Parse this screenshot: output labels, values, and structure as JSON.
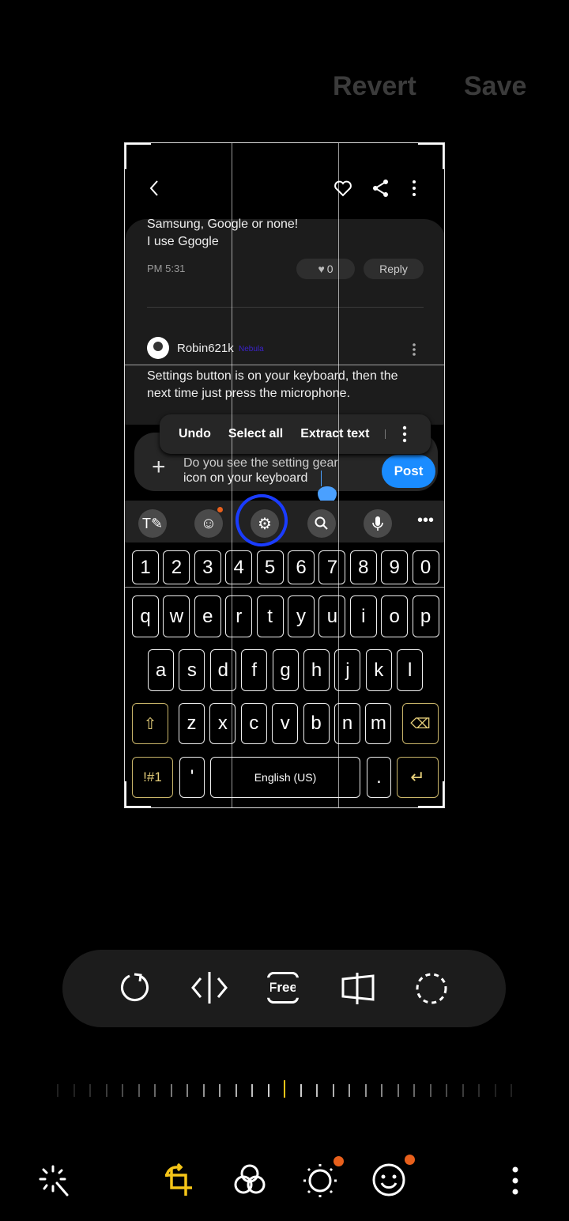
{
  "header": {
    "revert_label": "Revert",
    "save_label": "Save"
  },
  "screenshot": {
    "comment1": {
      "line1": "Samsung, Google or none!",
      "line2": "I use Ggogle",
      "time": "PM 5:31",
      "likes": "0",
      "reply_label": "Reply"
    },
    "comment2": {
      "user": "Robin621k",
      "badge": "Nebula",
      "text_line1": "Settings button is on your keyboard, then the",
      "text_line2": "next time just press the microphone."
    },
    "context_menu": {
      "undo": "Undo",
      "select_all": "Select all",
      "extract_text": "Extract text"
    },
    "compose": {
      "line1": "Do you see the setting gear",
      "line2": "icon on your keyboard",
      "post_label": "Post",
      "post_color": "#1a8cff"
    },
    "keyboard": {
      "toolbar_icons": [
        "text-edit-icon",
        "emoji-icon",
        "gear-icon",
        "search-icon",
        "microphone-icon",
        "more-icon"
      ],
      "row_numbers": [
        "1",
        "2",
        "3",
        "4",
        "5",
        "6",
        "7",
        "8",
        "9",
        "0"
      ],
      "row1": [
        "q",
        "w",
        "e",
        "r",
        "t",
        "y",
        "u",
        "i",
        "o",
        "p"
      ],
      "row2": [
        "a",
        "s",
        "d",
        "f",
        "g",
        "h",
        "j",
        "k",
        "l"
      ],
      "row3": [
        "z",
        "x",
        "c",
        "v",
        "b",
        "n",
        "m"
      ],
      "symbols_label": "!#1",
      "apostrophe": "'",
      "space_label": "English (US)",
      "period": ".",
      "annotation_color": "#1a3cff"
    }
  },
  "crop_tools": {
    "aspect_label": "Free",
    "icons": [
      "rotate-icon",
      "flip-icon",
      "free-aspect-icon",
      "perspective-icon",
      "lasso-icon"
    ]
  },
  "straighten_slider": {
    "value": 0
  },
  "bottom_tabs": {
    "icons": [
      "auto-enhance-icon",
      "crop-rotate-icon",
      "filters-icon",
      "brightness-icon",
      "decorations-icon",
      "more-icon"
    ],
    "active": "crop-rotate-icon",
    "active_color": "#f5c518",
    "dot_color": "#e8601c"
  }
}
